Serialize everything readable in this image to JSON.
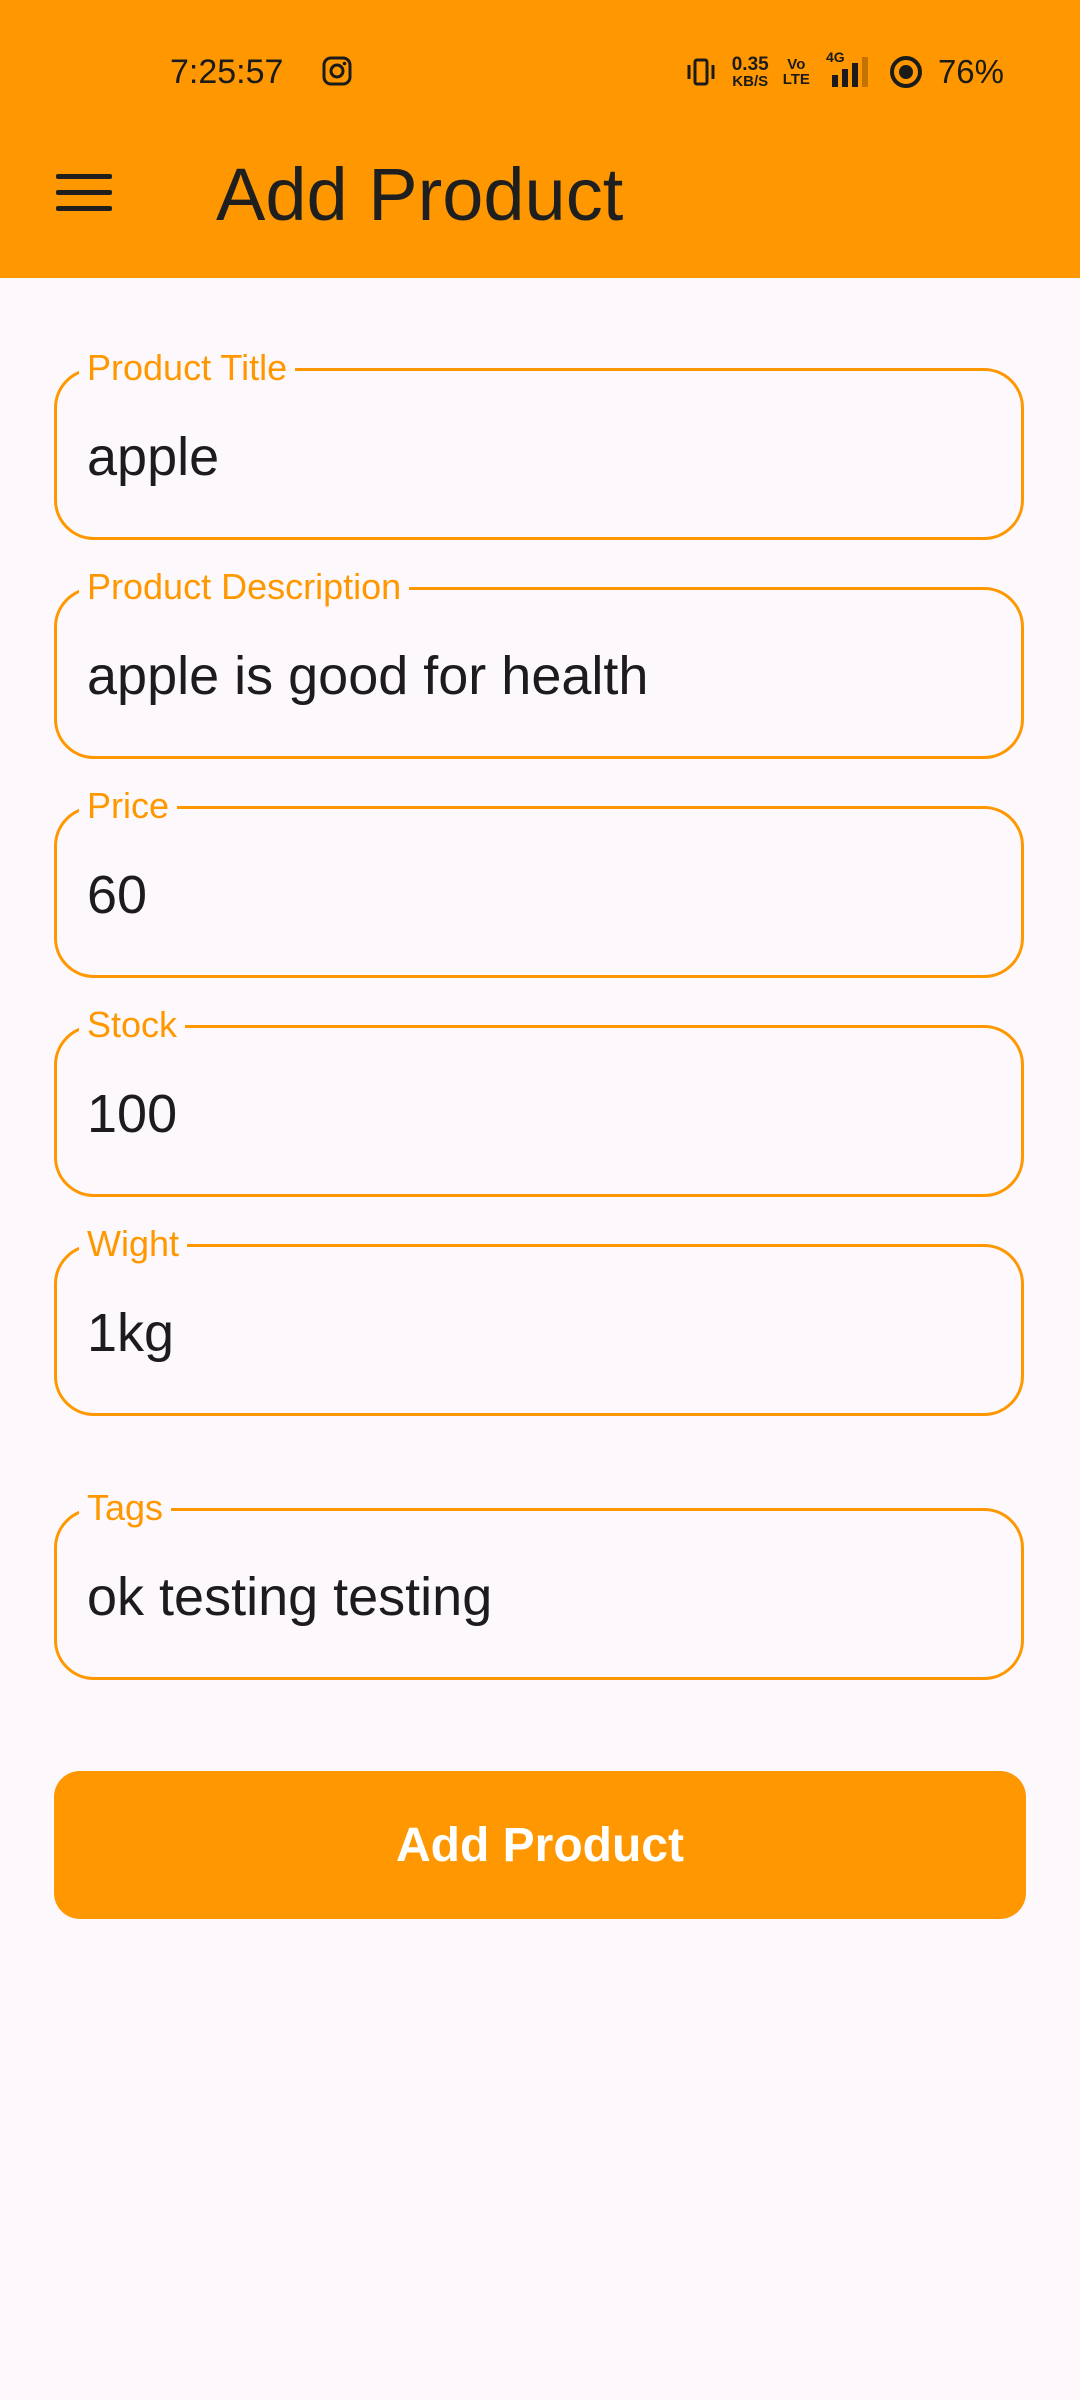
{
  "status_bar": {
    "time": "7:25:57",
    "net_speed_value": "0.35",
    "net_speed_unit": "KB/S",
    "volte_top": "Vo",
    "volte_bottom": "LTE",
    "network_type": "4G",
    "battery": "76%"
  },
  "appbar": {
    "title": "Add Product",
    "color": "#ff9800"
  },
  "form": {
    "fields": [
      {
        "label": "Product Title",
        "value": "apple"
      },
      {
        "label": "Product Description",
        "value": "apple is good for health"
      },
      {
        "label": "Price",
        "value": "60"
      },
      {
        "label": "Stock",
        "value": "100"
      },
      {
        "label": "Wight",
        "value": "1kg"
      },
      {
        "label": "Tags",
        "value": "ok testing testing"
      }
    ],
    "submit_label": "Add Product"
  }
}
